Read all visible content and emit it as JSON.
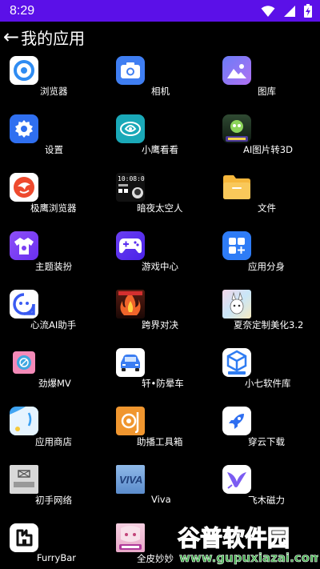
{
  "status_bar": {
    "time": "8:29"
  },
  "header": {
    "back_glyph": "←",
    "title": "我的应用"
  },
  "apps": [
    {
      "label": "浏览器",
      "icon": "browser-icon",
      "color": "#ffffff"
    },
    {
      "label": "相机",
      "icon": "camera-icon",
      "color": "#3f7ef2"
    },
    {
      "label": "图库",
      "icon": "gallery-icon",
      "color": "#8a6df5"
    },
    {
      "label": "设置",
      "icon": "gear-icon",
      "color": "#2f6ff0"
    },
    {
      "label": "小鹰看看",
      "icon": "eagle-icon",
      "color": "#1aa9b8"
    },
    {
      "label": "AI图片转3D",
      "icon": "ai-3d-icon",
      "color": "#1f3b2a"
    },
    {
      "label": "极鹰浏览器",
      "icon": "eagle-browser-icon",
      "color": "#ee4a2e"
    },
    {
      "label": "暗夜太空人",
      "icon": "astronaut-clock-icon",
      "color": "#111111"
    },
    {
      "label": "文件",
      "icon": "folder-icon",
      "color": "#f6b73c"
    },
    {
      "label": "主题装扮",
      "icon": "theme-shirt-icon",
      "color": "#7b3ff2"
    },
    {
      "label": "游戏中心",
      "icon": "gamepad-icon",
      "color": "#5a2ff0"
    },
    {
      "label": "应用分身",
      "icon": "app-clone-icon",
      "color": "#2e7cf6"
    },
    {
      "label": "心流AI助手",
      "icon": "ai-assistant-icon",
      "color": "#ffffff"
    },
    {
      "label": "跨界对决",
      "icon": "game-fire-icon",
      "color": "#3a1410"
    },
    {
      "label": "夏奈定制美化3.2",
      "icon": "anime-theme-icon",
      "color": "#e8e0f0"
    },
    {
      "label": "劲爆MV",
      "icon": "mv-icon",
      "color": "#e86aa8"
    },
    {
      "label": "轩•防晕车",
      "icon": "car-icon",
      "color": "#ffffff"
    },
    {
      "label": "小七软件库",
      "icon": "cube-icon",
      "color": "#ffffff"
    },
    {
      "label": "应用商店",
      "icon": "store-bag-icon",
      "color": "#4aa3f0"
    },
    {
      "label": "助播工具箱",
      "icon": "toolbox-icon",
      "color": "#f0962f"
    },
    {
      "label": "穿云下载",
      "icon": "rocket-icon",
      "color": "#ffffff"
    },
    {
      "label": "初手网络",
      "icon": "network-logo-icon",
      "color": "#d8d8d8"
    },
    {
      "label": "Viva",
      "icon": "viva-icon",
      "color": "#6fa0d8"
    },
    {
      "label": "飞木磁力",
      "icon": "bird-icon",
      "color": "#ffffff"
    },
    {
      "label": "FurryBar",
      "icon": "furrybar-icon",
      "color": "#ffffff"
    },
    {
      "label": "全皮妙妙",
      "icon": "anime-girl-icon",
      "color": "#f4c0d8"
    }
  ],
  "watermark": {
    "text": "谷普软件园",
    "url": "www.gupuxiazai.com"
  }
}
